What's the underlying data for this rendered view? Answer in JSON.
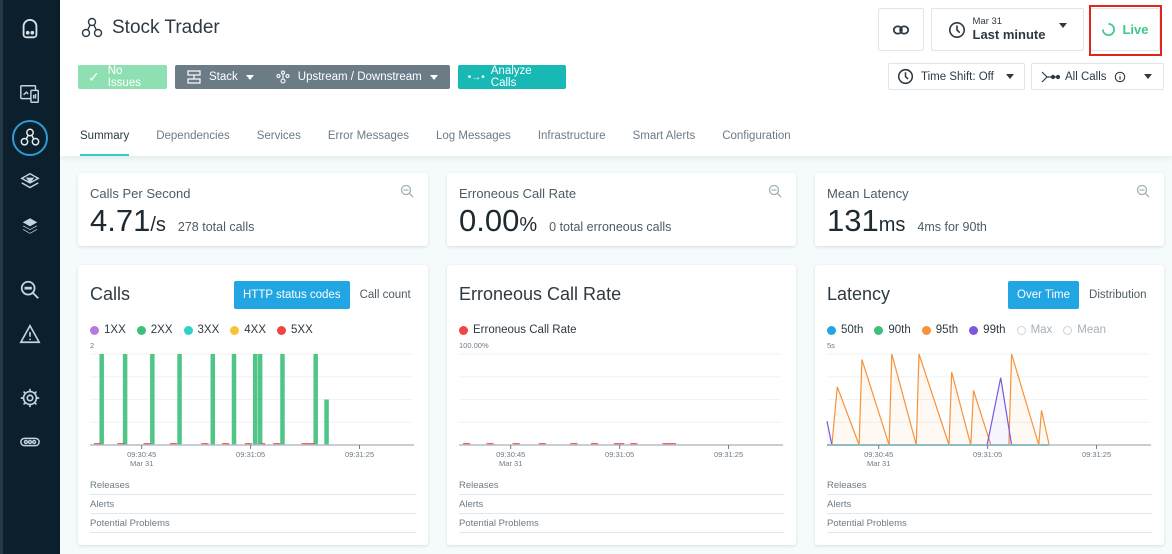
{
  "sidebar": {
    "items": [
      {
        "name": "logo-robot-icon"
      },
      {
        "name": "websites-mobile-icon"
      },
      {
        "name": "applications-icon",
        "active": true
      },
      {
        "name": "platforms-icon"
      },
      {
        "name": "infrastructure-stack-icon"
      },
      {
        "name": "analytics-search-icon"
      },
      {
        "name": "events-warning-icon"
      },
      {
        "name": "settings-gear-icon"
      },
      {
        "name": "more-icon"
      }
    ]
  },
  "header": {
    "title": "Stock Trader",
    "buttons": {
      "no_issues": "No Issues",
      "stack": "Stack",
      "upstream": "Upstream / Downstream",
      "analyze": "Analyze Calls"
    },
    "time": {
      "date": "Mar 31",
      "range": "Last minute"
    },
    "live": "Live",
    "time_shift": "Time Shift: Off",
    "all_calls": "All Calls"
  },
  "tabs": [
    {
      "label": "Summary",
      "active": true
    },
    {
      "label": "Dependencies"
    },
    {
      "label": "Services"
    },
    {
      "label": "Error Messages"
    },
    {
      "label": "Log Messages"
    },
    {
      "label": "Infrastructure"
    },
    {
      "label": "Smart Alerts"
    },
    {
      "label": "Configuration"
    }
  ],
  "stats": [
    {
      "label": "Calls Per Second",
      "value": "4.71",
      "unit": "/s",
      "sub": "278 total calls"
    },
    {
      "label": "Erroneous Call Rate",
      "value": "0.00",
      "unit": "%",
      "sub": "0 total erroneous calls"
    },
    {
      "label": "Mean Latency",
      "value": "131",
      "unit": "ms",
      "sub": "4ms for 90th"
    }
  ],
  "panels": {
    "calls": {
      "title": "Calls",
      "toggle_on": "HTTP status codes",
      "toggle_off": "Call count",
      "legend": [
        {
          "label": "1XX",
          "color": "#b57ae0"
        },
        {
          "label": "2XX",
          "color": "#3cbf7a"
        },
        {
          "label": "3XX",
          "color": "#2fd0c9"
        },
        {
          "label": "4XX",
          "color": "#f7c330"
        },
        {
          "label": "5XX",
          "color": "#ef4545"
        }
      ]
    },
    "erroneous": {
      "title": "Erroneous Call Rate",
      "legend": [
        {
          "label": "Erroneous Call Rate",
          "color": "#ef4545"
        }
      ]
    },
    "latency": {
      "title": "Latency",
      "toggle_on": "Over Time",
      "toggle_off": "Distribution",
      "legend": [
        {
          "label": "50th",
          "color": "#22a6e3"
        },
        {
          "label": "90th",
          "color": "#3cbf7a"
        },
        {
          "label": "95th",
          "color": "#f7913a"
        },
        {
          "label": "99th",
          "color": "#7b57e0"
        },
        {
          "label": "Max",
          "color": null
        },
        {
          "label": "Mean",
          "color": null
        }
      ]
    },
    "footer_rows": [
      "Releases",
      "Alerts",
      "Potential Problems"
    ]
  },
  "chart_data": [
    {
      "type": "bar",
      "title": "Calls",
      "ylabel_top": "2",
      "ylim": [
        0,
        2
      ],
      "x_ticks": [
        {
          "t": 45,
          "label": "09:30:45",
          "sub": "Mar 31"
        },
        {
          "t": 65,
          "label": "09:31:05"
        },
        {
          "t": 85,
          "label": "09:31:25"
        }
      ],
      "x_range_seconds": [
        35.5,
        95
      ],
      "series": [
        {
          "name": "2XX",
          "color": "#3cbf7a",
          "points": [
            [
              37.6,
              2
            ],
            [
              41.9,
              2
            ],
            [
              46.9,
              2
            ],
            [
              51.9,
              2
            ],
            [
              58,
              2
            ],
            [
              61.9,
              2
            ],
            [
              65.8,
              2
            ],
            [
              66.7,
              2
            ],
            [
              70.8,
              2
            ],
            [
              76.9,
              2
            ],
            [
              78.9,
              1
            ]
          ]
        },
        {
          "name": "5XX",
          "color": "#ef4545",
          "points": [
            [
              36.6,
              0
            ],
            [
              37.2,
              0
            ],
            [
              40.9,
              0
            ],
            [
              41.5,
              0
            ],
            [
              45.7,
              0
            ],
            [
              46.3,
              0
            ],
            [
              50.5,
              0
            ],
            [
              51.1,
              0
            ],
            [
              56.3,
              0
            ],
            [
              56.9,
              0
            ],
            [
              60.1,
              0
            ],
            [
              60.7,
              0
            ],
            [
              64.3,
              0
            ],
            [
              64.9,
              0
            ],
            [
              67.3,
              0
            ],
            [
              69.5,
              0
            ],
            [
              70.1,
              0
            ],
            [
              74.7,
              0
            ],
            [
              75.3,
              0
            ],
            [
              75.9,
              0
            ],
            [
              76.5,
              0
            ]
          ]
        }
      ]
    },
    {
      "type": "line",
      "title": "Erroneous Call Rate",
      "ylabel_top": "100.00%",
      "ylim": [
        0,
        100
      ],
      "x_ticks": [
        {
          "t": 45,
          "label": "09:30:45",
          "sub": "Mar 31"
        },
        {
          "t": 65,
          "label": "09:31:05"
        },
        {
          "t": 85,
          "label": "09:31:25"
        }
      ],
      "x_range_seconds": [
        35.5,
        95
      ],
      "series": [
        {
          "name": "Erroneous Call Rate",
          "color": "#ef4545",
          "points": [
            [
              36.6,
              0
            ],
            [
              37.2,
              0
            ],
            [
              40.9,
              0
            ],
            [
              41.5,
              0
            ],
            [
              45.7,
              0
            ],
            [
              46.3,
              0
            ],
            [
              50.5,
              0
            ],
            [
              51.1,
              0
            ],
            [
              56.3,
              0
            ],
            [
              56.9,
              0
            ],
            [
              60.1,
              0
            ],
            [
              60.7,
              0
            ],
            [
              64.3,
              0
            ],
            [
              64.9,
              0
            ],
            [
              65.5,
              0
            ],
            [
              67.3,
              0
            ],
            [
              67.9,
              0
            ],
            [
              73.2,
              0
            ],
            [
              73.8,
              0
            ],
            [
              74.4,
              0
            ],
            [
              75,
              0
            ]
          ]
        }
      ]
    },
    {
      "type": "area",
      "title": "Latency",
      "ylabel_top": "5s",
      "ylim": [
        0,
        5
      ],
      "x_ticks": [
        {
          "t": 45,
          "label": "09:30:45",
          "sub": "Mar 31"
        },
        {
          "t": 65,
          "label": "09:31:05"
        },
        {
          "t": 85,
          "label": "09:31:25"
        }
      ],
      "x_range_seconds": [
        35.5,
        95
      ],
      "series": [
        {
          "name": "95th",
          "color": "#f7913a",
          "points": [
            [
              36.4,
              0
            ],
            [
              37.4,
              3.2
            ],
            [
              41.4,
              0
            ],
            [
              41.9,
              4.7
            ],
            [
              46.9,
              0
            ],
            [
              47.4,
              5
            ],
            [
              51.9,
              0
            ],
            [
              52.4,
              5
            ],
            [
              57.9,
              0
            ],
            [
              58.4,
              4
            ],
            [
              61.9,
              0
            ],
            [
              62.4,
              3
            ],
            [
              65.6,
              0
            ],
            [
              68.9,
              0
            ],
            [
              69.4,
              5
            ],
            [
              74.4,
              0
            ],
            [
              74.9,
              1.9
            ],
            [
              76.3,
              0
            ]
          ]
        },
        {
          "name": "99th",
          "color": "#7b57e0",
          "points": [
            [
              35.5,
              1.3
            ],
            [
              36.4,
              0
            ],
            [
              64.9,
              0
            ],
            [
              67.4,
              3.7
            ],
            [
              69.4,
              0
            ]
          ]
        },
        {
          "name": "50th",
          "color": "#22a6e3",
          "points": [
            [
              35.5,
              0
            ],
            [
              76.3,
              0
            ]
          ]
        },
        {
          "name": "90th",
          "color": "#3cbf7a",
          "points": [
            [
              35.5,
              0
            ],
            [
              76.3,
              0
            ]
          ]
        }
      ]
    }
  ]
}
